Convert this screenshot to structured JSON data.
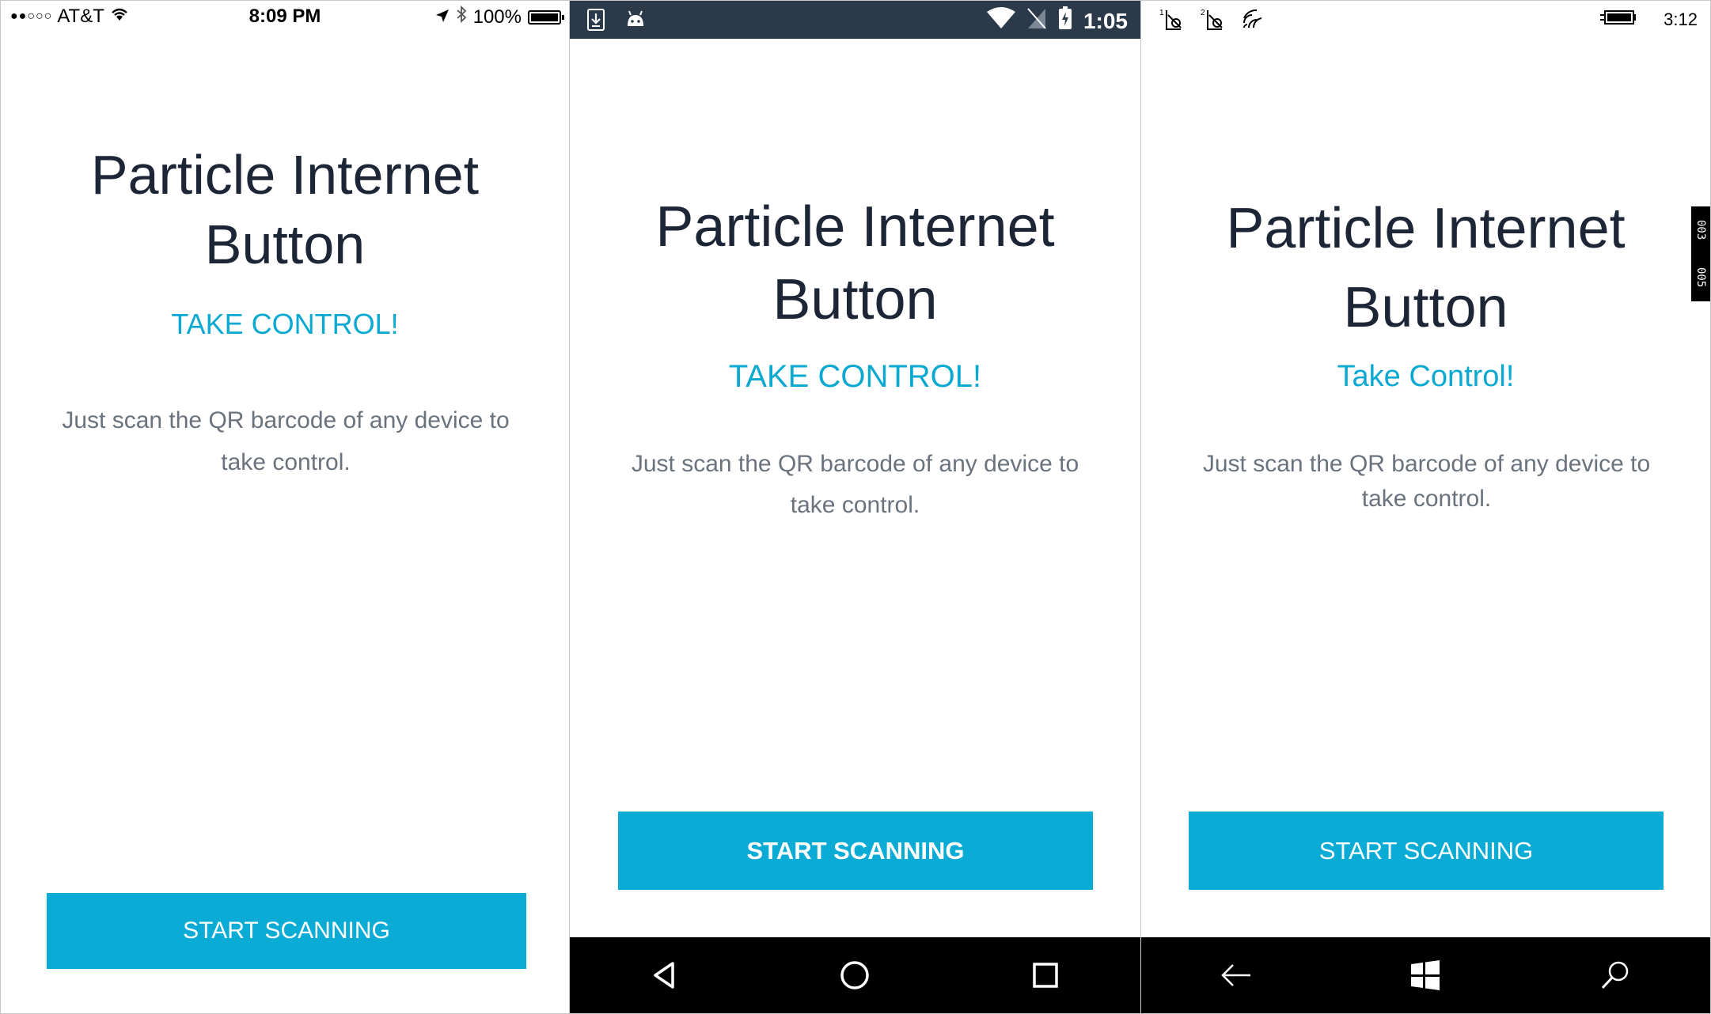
{
  "ios": {
    "status": {
      "signal_dots": "●●○○○",
      "carrier": "AT&T",
      "time": "8:09 PM",
      "battery": "100%",
      "icons": [
        "signal-dots-icon",
        "wifi-icon",
        "location-arrow-icon",
        "bluetooth-icon",
        "battery-icon"
      ]
    },
    "title_line1": "Particle Internet",
    "title_line2": "Button",
    "subtitle": "TAKE CONTROL!",
    "description": "Just scan the QR barcode of any device to take control.",
    "button_label": "START SCANNING"
  },
  "android": {
    "status": {
      "time": "1:05",
      "icons": [
        "download-notification-icon",
        "android-debug-icon",
        "wifi-icon",
        "no-sim-icon",
        "battery-charging-icon"
      ]
    },
    "title_line1": "Particle Internet",
    "title_line2": "Button",
    "subtitle": "TAKE CONTROL!",
    "description": "Just scan the QR barcode of any device to take control.",
    "button_label": "START SCANNING",
    "nav": [
      "back-icon",
      "home-icon",
      "recents-icon"
    ]
  },
  "windows": {
    "status": {
      "time": "3:12",
      "sim1": "1",
      "sim2": "2",
      "icons": [
        "sim1-no-signal-icon",
        "sim2-no-signal-icon",
        "wifi-icon",
        "battery-charging-icon"
      ]
    },
    "title_line1": "Particle Internet",
    "title_line2": "Button",
    "subtitle": "Take Control!",
    "description": "Just scan the QR barcode of any device to take control.",
    "button_label": "START SCANNING",
    "nav": [
      "back-arrow-icon",
      "windows-start-icon",
      "search-icon"
    ],
    "frame_counter": [
      "003",
      "005"
    ]
  },
  "colors": {
    "accent": "#0aacd6",
    "title": "#1c2636",
    "description": "#6a737d",
    "android_status_bar": "#2a3a4a",
    "nav_bar": "#000000"
  }
}
